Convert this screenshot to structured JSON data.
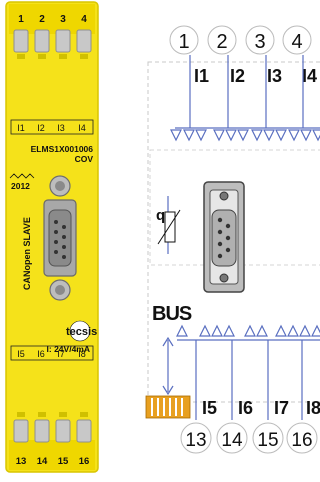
{
  "device": {
    "top_terminals": [
      "1",
      "2",
      "3",
      "4"
    ],
    "top_input_labels": [
      "I1",
      "I2",
      "I3",
      "I4"
    ],
    "model_number": "ELMS1X001006",
    "model_variant": "COV",
    "year": "2012",
    "product_name": "CANopen SLAVE",
    "brand": "tecsis",
    "rating": "I: 24V/4mA",
    "bottom_input_labels": [
      "I5",
      "I6",
      "I7",
      "I8"
    ],
    "bottom_terminals": [
      "13",
      "14",
      "15",
      "16"
    ]
  },
  "diagram": {
    "top_terminals": [
      "1",
      "2",
      "3",
      "4"
    ],
    "top_input_labels": [
      "I1",
      "I2",
      "I3",
      "I4"
    ],
    "bus_label": "BUS",
    "bottom_input_labels": [
      "I5",
      "I6",
      "I7",
      "I8"
    ],
    "bottom_terminals": [
      "13",
      "14",
      "15",
      "16"
    ]
  },
  "colors": {
    "housing_yellow": "#f5e21a",
    "housing_edge": "#d9c500",
    "screw_grey": "#b9b9b9",
    "connector_grey": "#9a9a9a",
    "line_blue": "#5a6fc0",
    "bus_orange": "#e8a020",
    "ink": "#111111"
  }
}
